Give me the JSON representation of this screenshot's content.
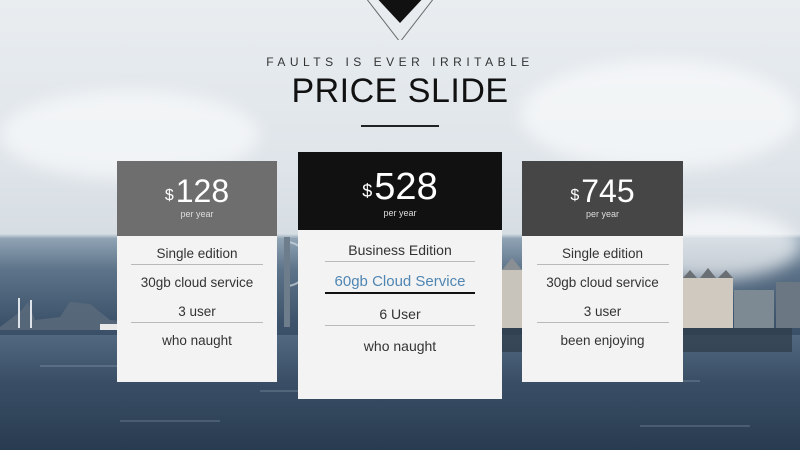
{
  "header": {
    "subtitle": "FAULTS IS EVER IRRITABLE",
    "title": "PRICE SLIDE"
  },
  "plans": [
    {
      "currency": "$",
      "price": "128",
      "period": "per year",
      "features": [
        "Single edition",
        "30gb cloud service",
        "3 user",
        "who naught"
      ]
    },
    {
      "currency": "$",
      "price": "528",
      "period": "per year",
      "features": [
        "Business Edition",
        "60gb Cloud Service",
        "6 User",
        "who naught"
      ]
    },
    {
      "currency": "$",
      "price": "745",
      "period": "per year",
      "features": [
        "Single edition",
        "30gb cloud service",
        "3 user",
        "been enjoying"
      ]
    }
  ],
  "colors": {
    "highlight_text": "#4f86b3",
    "featured_header": "#111111",
    "plan1_header": "#6e6e6e",
    "plan3_header": "#464646"
  }
}
